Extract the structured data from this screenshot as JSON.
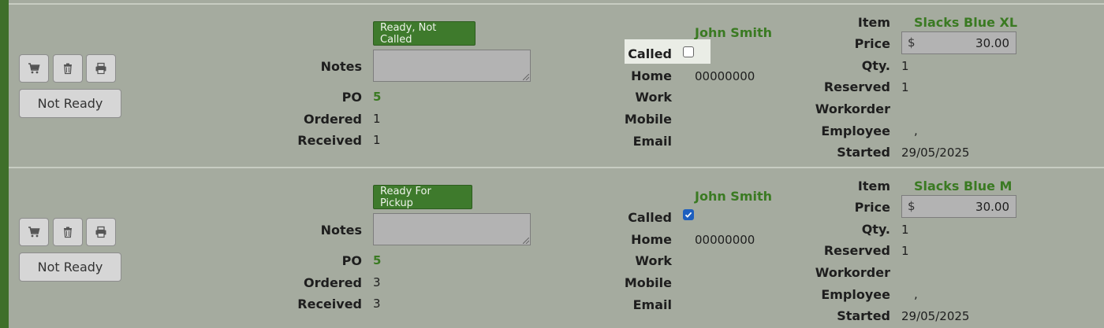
{
  "labels": {
    "notes": "Notes",
    "po": "PO",
    "ordered": "Ordered",
    "received": "Received",
    "called": "Called",
    "home": "Home",
    "work": "Work",
    "mobile": "Mobile",
    "email": "Email",
    "item": "Item",
    "price": "Price",
    "qty": "Qty.",
    "reserved": "Reserved",
    "workorder": "Workorder",
    "employee": "Employee",
    "started": "Started",
    "currency": "$"
  },
  "orders": [
    {
      "action_label": "Not Ready",
      "status_label": "Ready, Not Called",
      "notes": "",
      "po": "5",
      "ordered": "1",
      "received": "1",
      "customer_name": "John Smith",
      "called": false,
      "home": "00000000",
      "work": "",
      "mobile": "",
      "email": "",
      "item": "Slacks Blue XL",
      "price": "30.00",
      "qty": "1",
      "reserved": "1",
      "workorder": "",
      "employee": ",",
      "started": "29/05/2025"
    },
    {
      "action_label": "Not Ready",
      "status_label": "Ready For Pickup",
      "notes": "",
      "po": "5",
      "ordered": "3",
      "received": "3",
      "customer_name": "John Smith",
      "called": true,
      "home": "00000000",
      "work": "",
      "mobile": "",
      "email": "",
      "item": "Slacks Blue M",
      "price": "30.00",
      "qty": "1",
      "reserved": "1",
      "workorder": "",
      "employee": ",",
      "started": "29/05/2025"
    }
  ],
  "icons": [
    "cart-icon",
    "trash-icon",
    "print-icon",
    "checkmark-icon"
  ],
  "colors": {
    "accent_green": "#3e7a2c",
    "name_green": "#3a7a22",
    "row_background": "#a5ab9f",
    "checkbox_checked": "#1d5fbf"
  }
}
